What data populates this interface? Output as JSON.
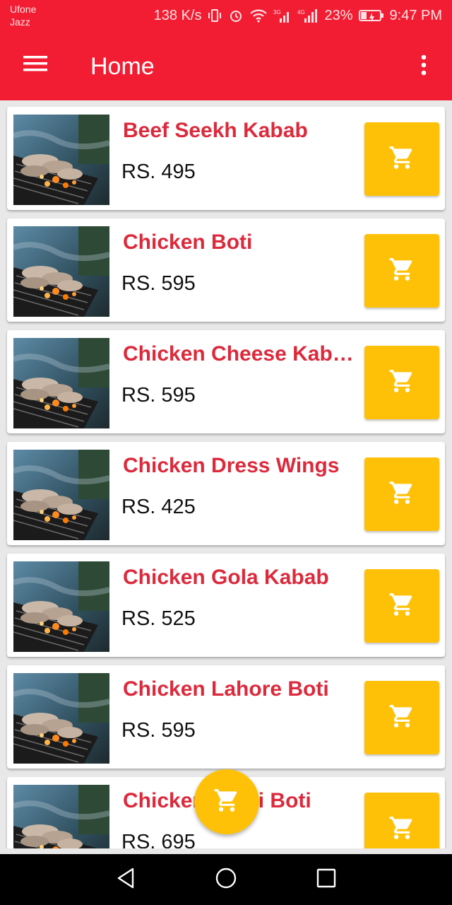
{
  "statusbar": {
    "carrier_line1": "Ufone",
    "carrier_line2": "Jazz",
    "net_speed": "138 K/s",
    "signal1_label": "3G",
    "signal2_label": "4G",
    "battery": "23%",
    "time": "9:47 PM"
  },
  "appbar": {
    "title": "Home"
  },
  "colors": {
    "primary": "#f21d32",
    "accent": "#ffc107",
    "item_name": "#dc2a3c"
  },
  "items": [
    {
      "name": "Beef Seekh Kabab",
      "price": "RS. 495"
    },
    {
      "name": "Chicken Boti",
      "price": "RS. 595"
    },
    {
      "name": "Chicken Cheese Kabab",
      "price": "RS. 595"
    },
    {
      "name": "Chicken Dress Wings",
      "price": "RS. 425"
    },
    {
      "name": "Chicken Gola Kabab",
      "price": "RS. 525"
    },
    {
      "name": "Chicken Lahore Boti",
      "price": "RS. 595"
    },
    {
      "name": "Chicken Malai Boti",
      "price": "RS. 695"
    }
  ],
  "icons": {
    "menu": "hamburger-menu-icon",
    "overflow": "more-vert-icon",
    "cart": "shopping-cart-icon",
    "fab": "shopping-cart-icon",
    "nav_back": "triangle-back-icon",
    "nav_home": "circle-home-icon",
    "nav_recents": "square-recents-icon"
  }
}
